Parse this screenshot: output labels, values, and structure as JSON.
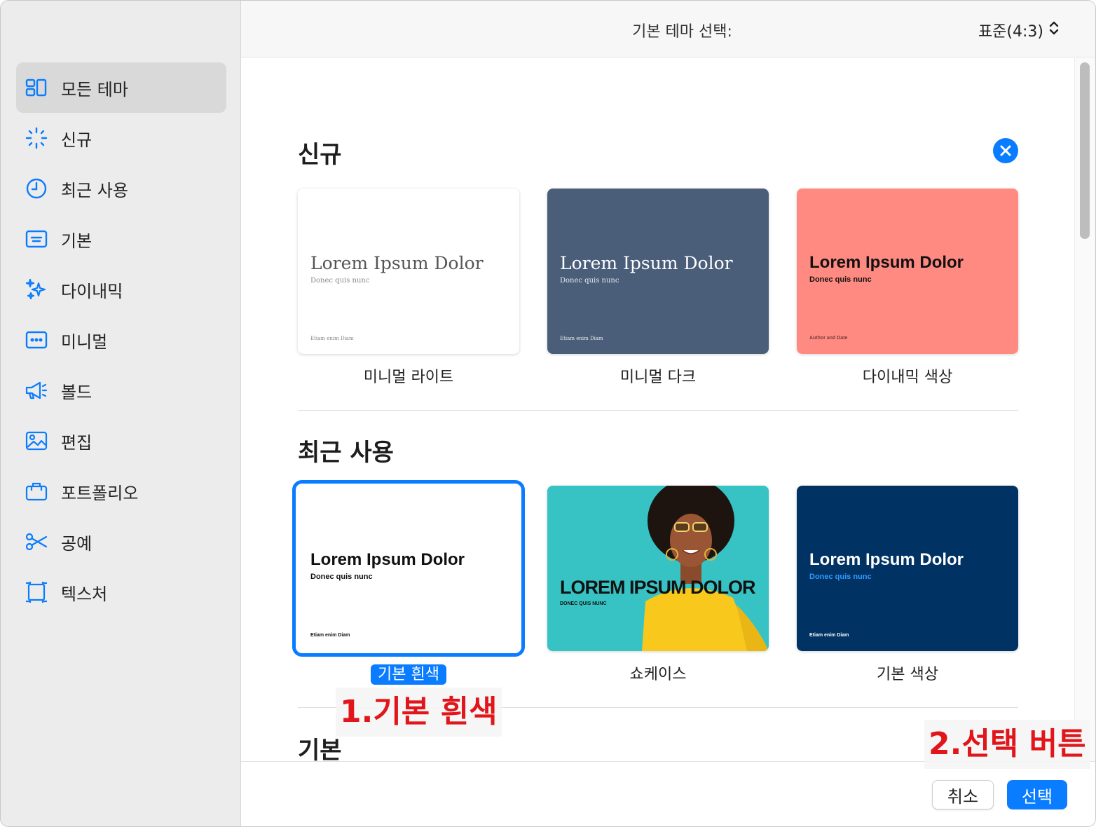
{
  "header": {
    "title": "기본 테마 선택:",
    "size_value": "표준(4:3)"
  },
  "sidebar": {
    "items": [
      {
        "label": "모든 테마",
        "icon": "grid-icon"
      },
      {
        "label": "신규",
        "icon": "sparkle-burst-icon"
      },
      {
        "label": "최근 사용",
        "icon": "clock-icon"
      },
      {
        "label": "기본",
        "icon": "basic-slide-icon"
      },
      {
        "label": "다이내믹",
        "icon": "sparkles-icon"
      },
      {
        "label": "미니멀",
        "icon": "dots-slide-icon"
      },
      {
        "label": "볼드",
        "icon": "megaphone-icon"
      },
      {
        "label": "편집",
        "icon": "photo-icon"
      },
      {
        "label": "포트폴리오",
        "icon": "briefcase-icon"
      },
      {
        "label": "공예",
        "icon": "scissors-icon"
      },
      {
        "label": "텍스처",
        "icon": "texture-frame-icon"
      }
    ]
  },
  "sections": {
    "new": {
      "title": "신규",
      "themes": [
        {
          "label": "미니멀 라이트",
          "title": "Lorem Ipsum Dolor",
          "subtitle": "Donec quis nunc",
          "footer": "Etiam enim Diam"
        },
        {
          "label": "미니멀 다크",
          "title": "Lorem Ipsum Dolor",
          "subtitle": "Donec quis nunc",
          "footer": "Etiam enim Diam"
        },
        {
          "label": "다이내믹 색상",
          "title": "Lorem Ipsum Dolor",
          "subtitle": "Donec quis nunc",
          "footer": "Author and Date"
        }
      ]
    },
    "recent": {
      "title": "최근 사용",
      "themes": [
        {
          "label": "기본 흰색",
          "title": "Lorem Ipsum Dolor",
          "subtitle": "Donec quis nunc",
          "footer": "Etiam enim Diam"
        },
        {
          "label": "쇼케이스",
          "title": "LOREM IPSUM DOLOR",
          "subtitle": "DONEC QUIS NUNC"
        },
        {
          "label": "기본 색상",
          "title": "Lorem Ipsum Dolor",
          "subtitle": "Donec quis nunc",
          "footer": "Etiam enim Diam"
        }
      ]
    },
    "basic": {
      "title": "기본"
    }
  },
  "footer": {
    "cancel_label": "취소",
    "select_label": "선택"
  },
  "annotations": {
    "step1": "1.기본 흰색",
    "step2": "2.선택 버튼"
  },
  "colors": {
    "accent": "#0a7cff",
    "dark_slate": "#4a5e7a",
    "coral": "#ff8a82",
    "navy": "#003263",
    "teal": "#35c9c9",
    "annotation_red": "#e0161b"
  }
}
